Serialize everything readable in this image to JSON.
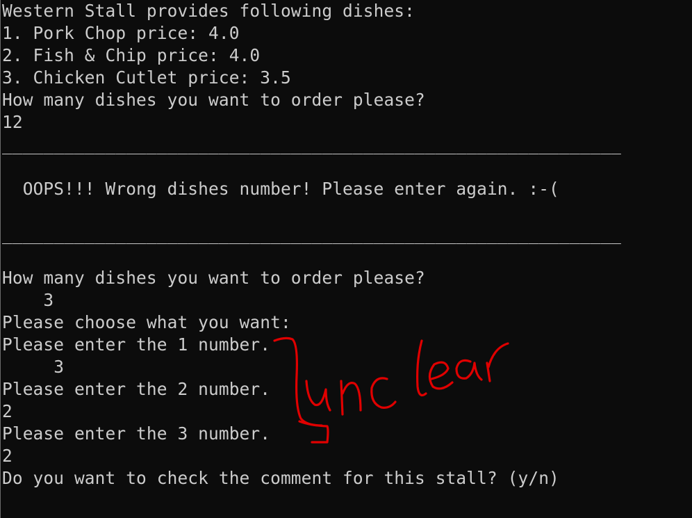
{
  "console": {
    "lines": [
      "Western Stall provides following dishes:",
      "1. Pork Chop price: 4.0",
      "2. Fish & Chip price: 4.0",
      "3. Chicken Cutlet price: 3.5",
      "How many dishes you want to order please?",
      "12",
      "____________________________________________________________",
      "",
      "  OOPS!!! Wrong dishes number! Please enter again. :-(",
      "",
      "",
      "____________________________________________________________",
      "",
      "How many dishes you want to order please?",
      "    3",
      "Please choose what you want:",
      "Please enter the 1 number.",
      "     3",
      "Please enter the 2 number.",
      "2",
      "Please enter the 3 number.",
      "2",
      "Do you want to check the comment for this stall? (y/n)"
    ]
  },
  "annotation": {
    "text": "unclear",
    "color": "#e00000"
  }
}
